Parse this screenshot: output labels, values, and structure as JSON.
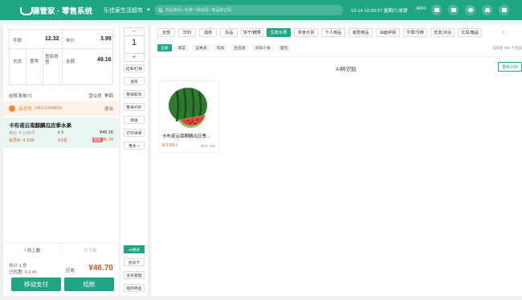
{
  "topbar": {
    "logo_text": "德管家 · 零售系统",
    "store": "乐佳家生活超市",
    "search_placeholder": "商品条码 / 名称 / 拼音码 / 商品助记码",
    "datetime": "10-14 10:30:27 星期六",
    "cashier": "收银",
    "code": "9001",
    "icons": [
      "printer-icon",
      "screen-icon",
      "message-icon",
      "wifi-icon",
      "lock-icon"
    ]
  },
  "summary": {
    "pieces_label": "件数",
    "pieces_value": "12.32",
    "price_label": "单价",
    "price_value": "3.99",
    "buttons": [
      "去皮",
      "置零",
      "重新联登"
    ],
    "amount_label": "金额",
    "amount_value": "49.16"
  },
  "order": {
    "list_label": "结账清单(7)",
    "role_label": "营业员",
    "role_value": "李四",
    "member_label": "会员号",
    "member_no": "18612345809",
    "exit_label": "退出"
  },
  "cart_item": {
    "name": "卡布诺云南麒麟瓜应季水果",
    "orig_price": "单价: ¥ 3.99/斤",
    "qty": "x 1",
    "orig_total": "¥49.16",
    "member_price": "会员价: ¥ 3.88",
    "discount": "9.5折",
    "tag": "促销",
    "total": "¥46.70"
  },
  "pager": {
    "prev": "向上翻",
    "next": "向下翻"
  },
  "totals": {
    "count": "共计 1 件",
    "discount_label": "已优惠:",
    "discount_value": "¥ 2.46",
    "payable_label": "应收",
    "payable_value": "¥46.70"
  },
  "actions": {
    "move_pay": "移动支付",
    "checkout": "结账"
  },
  "stepper": {
    "minus": "−",
    "value": "1",
    "plus": "+"
  },
  "side_buttons": {
    "top": [
      "挂单/打单",
      "退货",
      "整单取消",
      "整单打折",
      "赠送",
      "打印清单",
      "更多 >"
    ],
    "bottom": [
      "AI模式",
      "会员卡",
      "会员管理",
      "临时商品"
    ]
  },
  "categories": [
    "全部",
    "饮料",
    "酒类",
    "冻品",
    "饼干/糖果",
    "生鲜水果",
    "零食炒货",
    "个人用品",
    "家居用品",
    "油面护肤",
    "牙膏/牙刷",
    "洗发/沐浴",
    "文具/箱品"
  ],
  "subcategories": [
    "全部",
    "蔬菜",
    "坚果类",
    "肉类",
    "昆虫类",
    "风味小食",
    "面包"
  ],
  "count_text": "当前有 300 个商品",
  "ai": {
    "title": "AI秤识别",
    "reidentify": "重新识别"
  },
  "product": {
    "name": "卡布诺云南麒麟瓜应季...",
    "price": "¥ 3.99",
    "unit": "/斤",
    "stock": "库存: 300"
  },
  "colors": {
    "brand": "#21a685",
    "price": "#e8541e",
    "member_bg": "#fdf1e8",
    "item_bg": "#e7f6f0"
  }
}
